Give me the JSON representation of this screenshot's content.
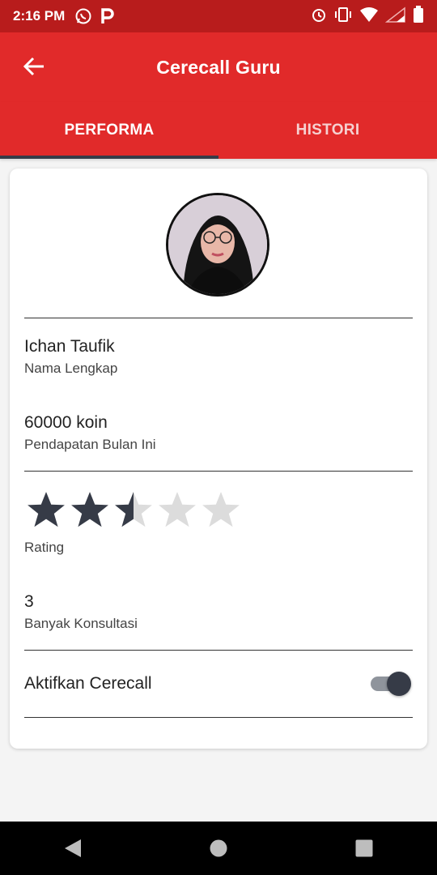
{
  "status_bar": {
    "time": "2:16 PM",
    "icons_left": [
      "whatsapp-icon",
      "p-app-icon"
    ],
    "icons_right": [
      "alarm-icon",
      "vibrate-icon",
      "wifi-icon",
      "signal-icon",
      "battery-icon"
    ]
  },
  "toolbar": {
    "title": "Cerecall Guru",
    "back_icon": "arrow-left-icon"
  },
  "tabs": [
    {
      "label": "PERFORMA",
      "active": true
    },
    {
      "label": "HISTORI",
      "active": false
    }
  ],
  "profile": {
    "name_value": "Ichan Taufik",
    "name_label": "Nama Lengkap",
    "income_value": "60000 koin",
    "income_label": "Pendapatan Bulan Ini",
    "rating_value": 2.5,
    "rating_max": 5,
    "rating_label": "Rating",
    "consult_value": "3",
    "consult_label": "Banyak Konsultasi",
    "toggle_label": "Aktifkan Cerecall",
    "toggle_on": true
  },
  "colors": {
    "primary": "#e12a2a",
    "status_bar": "#b81c1c",
    "accent_dark": "#363b47",
    "star_empty": "#dcdcdc"
  },
  "nav_bar": [
    "back-triangle-icon",
    "home-circle-icon",
    "recents-square-icon"
  ]
}
